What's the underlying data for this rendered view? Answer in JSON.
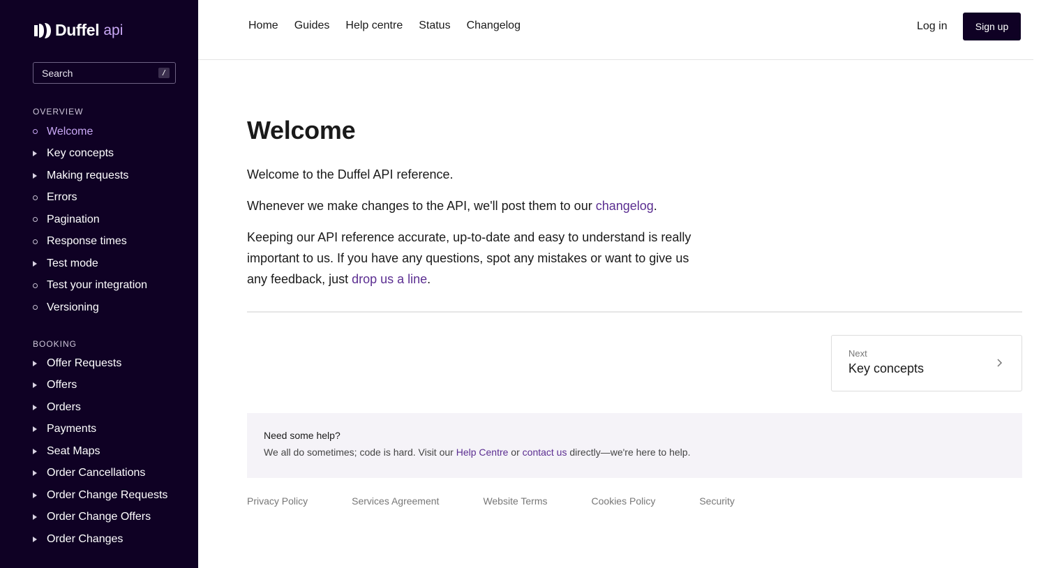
{
  "brand": {
    "name": "Duffel",
    "suffix": "api",
    "sidebar_bg": "#0f0124",
    "accent": "#c9a8f5",
    "link": "#5b2e91"
  },
  "search": {
    "label": "Search",
    "shortcut": "/"
  },
  "sidebar": {
    "sections": [
      {
        "title": "OVERVIEW",
        "items": [
          {
            "label": "Welcome",
            "marker": "dot",
            "active": true
          },
          {
            "label": "Key concepts",
            "marker": "triangle"
          },
          {
            "label": "Making requests",
            "marker": "triangle"
          },
          {
            "label": "Errors",
            "marker": "dot"
          },
          {
            "label": "Pagination",
            "marker": "dot"
          },
          {
            "label": "Response times",
            "marker": "dot"
          },
          {
            "label": "Test mode",
            "marker": "triangle"
          },
          {
            "label": "Test your integration",
            "marker": "dot"
          },
          {
            "label": "Versioning",
            "marker": "dot"
          }
        ]
      },
      {
        "title": "BOOKING",
        "items": [
          {
            "label": "Offer Requests",
            "marker": "triangle"
          },
          {
            "label": "Offers",
            "marker": "triangle"
          },
          {
            "label": "Orders",
            "marker": "triangle"
          },
          {
            "label": "Payments",
            "marker": "triangle"
          },
          {
            "label": "Seat Maps",
            "marker": "triangle"
          },
          {
            "label": "Order Cancellations",
            "marker": "triangle"
          },
          {
            "label": "Order Change Requests",
            "marker": "triangle"
          },
          {
            "label": "Order Change Offers",
            "marker": "triangle"
          },
          {
            "label": "Order Changes",
            "marker": "triangle"
          }
        ]
      }
    ]
  },
  "header": {
    "nav": [
      "Home",
      "Guides",
      "Help centre",
      "Status",
      "Changelog"
    ],
    "login": "Log in",
    "signup": "Sign up"
  },
  "main": {
    "title": "Welcome",
    "p1": "Welcome to the Duffel API reference.",
    "p2_before": "Whenever we make changes to the API, we'll post them to our ",
    "p2_link": "changelog",
    "p2_after": ".",
    "p3_before": "Keeping our API reference accurate, up-to-date and easy to understand is really important to us. If you have any questions, spot any mistakes or want to give us any feedback, just ",
    "p3_link": "drop us a line",
    "p3_after": ".",
    "next": {
      "label": "Next",
      "title": "Key concepts"
    },
    "help": {
      "title": "Need some help?",
      "text_before": "We all do sometimes; code is hard. Visit our ",
      "link1": "Help Centre",
      "text_middle": " or ",
      "link2": "contact us",
      "text_after": " directly—we're here to help."
    }
  },
  "footer": {
    "links": [
      "Privacy Policy",
      "Services Agreement",
      "Website Terms",
      "Cookies Policy",
      "Security"
    ]
  }
}
